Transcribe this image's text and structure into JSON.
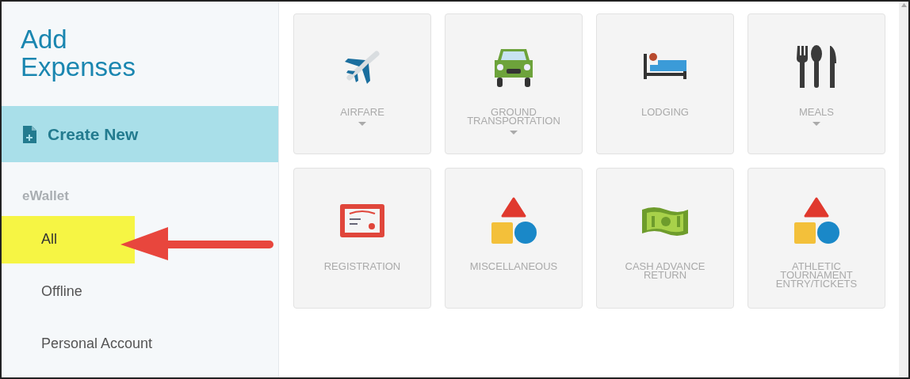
{
  "sidebar": {
    "title": "Add Expenses",
    "create_button": "Create New",
    "section_label": "eWallet",
    "items": [
      {
        "label": "All",
        "selected": true
      },
      {
        "label": "Offline",
        "selected": false
      },
      {
        "label": "Personal Account",
        "selected": false
      }
    ]
  },
  "annotation": {
    "kind": "arrow"
  },
  "tiles": [
    {
      "label": "AIRFARE",
      "kind": "plane",
      "dropdown": true
    },
    {
      "label": "GROUND TRANSPORTATION",
      "kind": "car",
      "dropdown": true
    },
    {
      "label": "LODGING",
      "kind": "bed",
      "dropdown": false
    },
    {
      "label": "MEALS",
      "kind": "utensils",
      "dropdown": true
    },
    {
      "label": "REGISTRATION",
      "kind": "certificate",
      "dropdown": false
    },
    {
      "label": "MISCELLANEOUS",
      "kind": "shapes",
      "dropdown": false
    },
    {
      "label": "CASH ADVANCE RETURN",
      "kind": "cash",
      "dropdown": false
    },
    {
      "label": "ATHLETIC TOURNAMENT ENTRY/TICKETS",
      "kind": "shapes",
      "dropdown": false
    }
  ]
}
